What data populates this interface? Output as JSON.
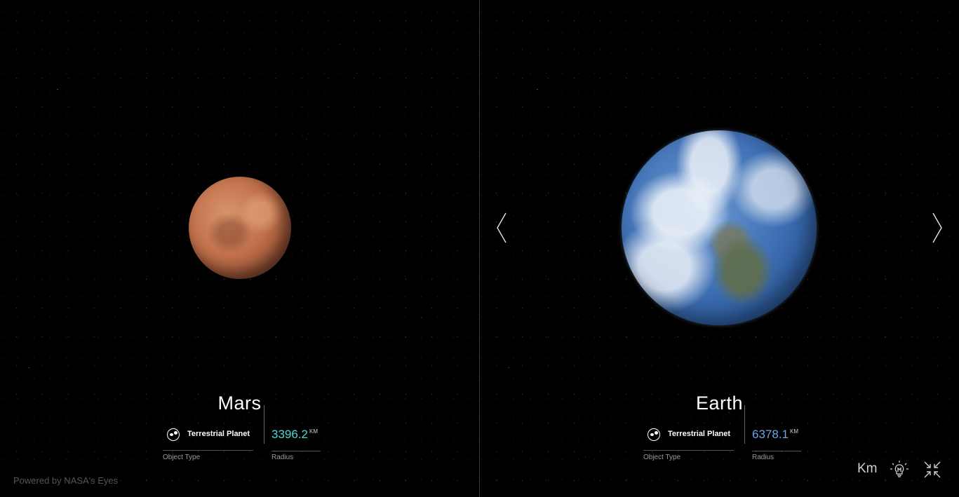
{
  "left_planet": {
    "name": "Mars",
    "object_type": "Terrestrial Planet",
    "object_type_caption": "Object Type",
    "radius_value": "3396.2",
    "radius_unit": "KM",
    "radius_caption": "Radius",
    "radius_color": "#4fd6d6"
  },
  "right_planet": {
    "name": "Earth",
    "object_type": "Terrestrial Planet",
    "object_type_caption": "Object Type",
    "radius_value": "6378.1",
    "radius_unit": "KM",
    "radius_caption": "Radius",
    "radius_color": "#6aa7e6"
  },
  "footer": {
    "powered_by": "Powered by NASA's Eyes"
  },
  "controls": {
    "units_label": "Km",
    "prev_icon": "chevron-left-icon",
    "next_icon": "chevron-right-icon",
    "light_icon": "lightbulb-icon",
    "collapse_icon": "collapse-icon"
  }
}
